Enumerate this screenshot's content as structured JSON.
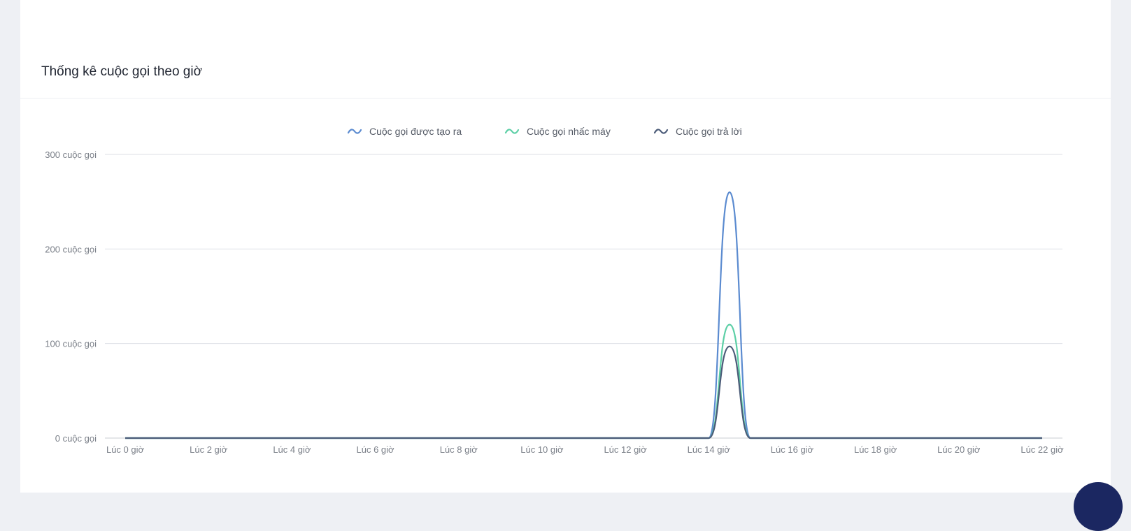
{
  "card": {
    "title": "Thống kê cuộc gọi theo giờ"
  },
  "colors": {
    "created": "#5b8bd0",
    "picked": "#5ccfa6",
    "answered": "#4b5b78",
    "grid": "#dcdfe4",
    "tick_text": "#7a7f88",
    "fab": "#1b2761"
  },
  "chart_data": {
    "type": "line",
    "title": "Thống kê cuộc gọi theo giờ",
    "x": [
      0,
      2,
      4,
      6,
      8,
      10,
      12,
      14,
      14.5,
      15,
      15.5,
      16,
      18,
      20,
      22
    ],
    "x_tick_labels": [
      "Lúc 0 giờ",
      "Lúc 2 giờ",
      "Lúc 4 giờ",
      "Lúc 6 giờ",
      "Lúc 8 giờ",
      "Lúc 10 giờ",
      "Lúc 12 giờ",
      "Lúc 14 giờ",
      "Lúc 16 giờ",
      "Lúc 18 giờ",
      "Lúc 20 giờ",
      "Lúc 22 giờ"
    ],
    "x_ticks": [
      0,
      2,
      4,
      6,
      8,
      10,
      12,
      14,
      16,
      18,
      20,
      22
    ],
    "y_ticks": [
      0,
      100,
      200,
      300
    ],
    "y_tick_labels": [
      "0 cuộc gọi",
      "100 cuộc gọi",
      "200 cuộc gọi",
      "300 cuộc gọi"
    ],
    "xlim": [
      0,
      22
    ],
    "ylim": [
      0,
      300
    ],
    "grid": true,
    "legend_position": "top",
    "series": [
      {
        "name": "Cuộc gọi được tạo ra",
        "color_key": "created",
        "values": [
          0,
          0,
          0,
          0,
          0,
          0,
          0,
          0,
          260,
          0,
          0,
          0,
          0,
          0,
          0
        ]
      },
      {
        "name": "Cuộc gọi nhấc máy",
        "color_key": "picked",
        "values": [
          0,
          0,
          0,
          0,
          0,
          0,
          0,
          0,
          120,
          0,
          0,
          0,
          0,
          0,
          0
        ]
      },
      {
        "name": "Cuộc gọi trả lời",
        "color_key": "answered",
        "values": [
          0,
          0,
          0,
          0,
          0,
          0,
          0,
          0,
          97,
          0,
          0,
          0,
          0,
          0,
          0
        ]
      }
    ]
  }
}
